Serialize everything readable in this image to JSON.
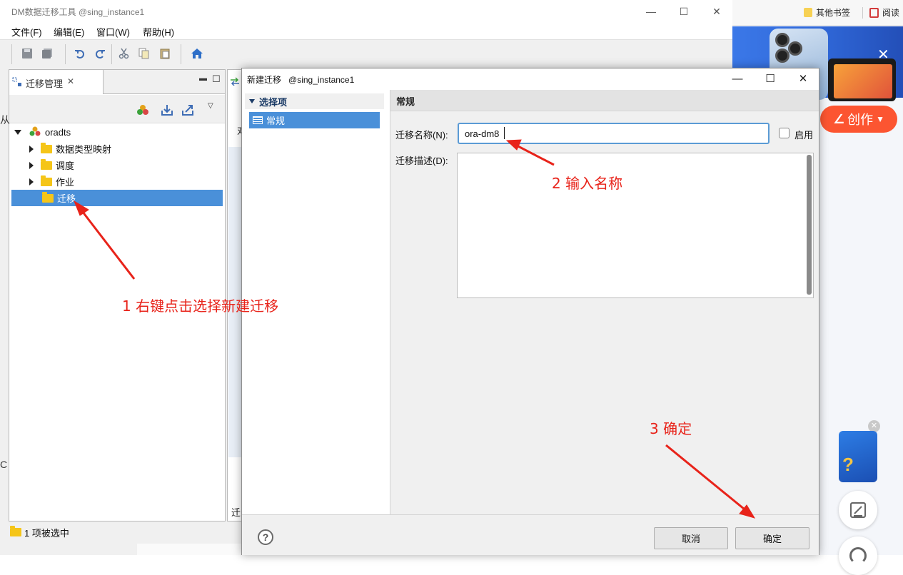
{
  "dm_window": {
    "title": "DM数据迁移工具 @sing_instance1",
    "menu": [
      "文件(F)",
      "编辑(E)",
      "窗口(W)",
      "帮助(H)"
    ]
  },
  "left_view": {
    "tab_label": "迁移管理",
    "tree": {
      "root": "oradts",
      "children": [
        "数据类型映射",
        "调度",
        "作业",
        "迁移"
      ],
      "selected": "迁移"
    }
  },
  "mid_view": {
    "fragment_top": "对",
    "fragment_bottom": "迁"
  },
  "status_bar": {
    "text": "1 项被选中"
  },
  "dialog": {
    "title": "新建迁移",
    "instance": "@sing_instance1",
    "nav": {
      "header": "选择项",
      "item": "常规"
    },
    "section_title": "常规",
    "name_label": "迁移名称(N):",
    "name_value": "ora-dm8",
    "enable_label": "启用",
    "desc_label": "迁移描述(D):",
    "cancel_label": "取消",
    "ok_label": "确定",
    "help_label": "?"
  },
  "browser": {
    "bookmark_other": "其他书签",
    "bookmark_read": "阅读",
    "create_label": "创作",
    "left_edge_top": "从",
    "left_edge_bottom": "C"
  },
  "annotations": {
    "step1": "1 右键点击选择新建迁移",
    "step2": "2 输入名称",
    "step3": "3 确定",
    "color": "#e8231a"
  }
}
